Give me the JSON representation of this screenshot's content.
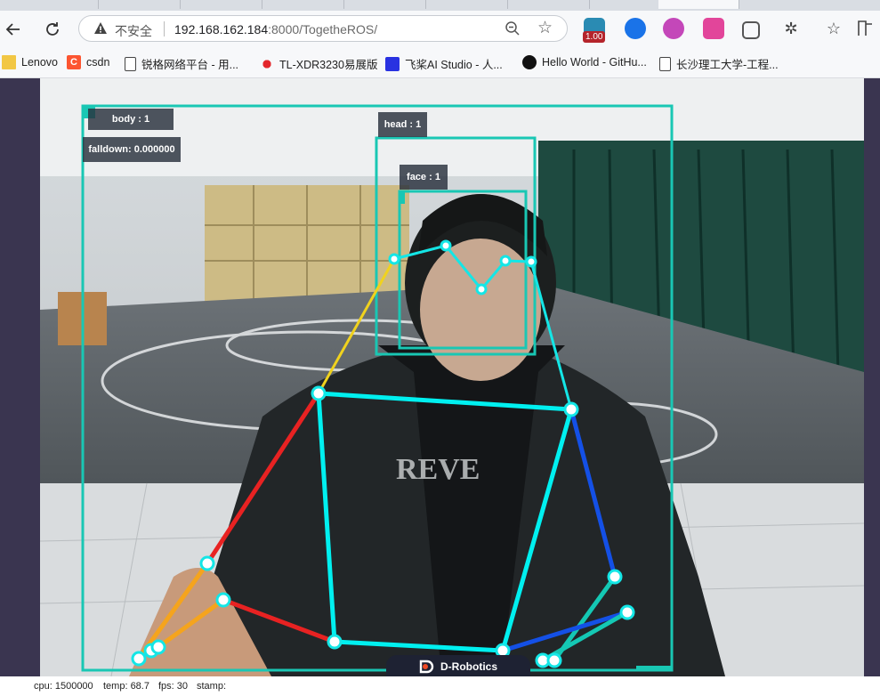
{
  "browser": {
    "security_label": "不安全",
    "url_host": "192.168.162.184",
    "url_rest": ":8000/TogetheROS/",
    "ext_badge": "1.00",
    "bookmarks": [
      {
        "label": "Lenovo",
        "icon": "folder-icon",
        "color": "#f2c744"
      },
      {
        "label": "csdn",
        "icon": "csdn-icon",
        "color": "#fc5531"
      },
      {
        "label": "锐格网络平台 - 用...",
        "icon": "page-icon",
        "color": "#ffffff"
      },
      {
        "label": "TL-XDR3230易展版",
        "icon": "huawei-icon",
        "color": "#e3262b"
      },
      {
        "label": "飞桨AI Studio - 人...",
        "icon": "paddle-icon",
        "color": "#2932e1"
      },
      {
        "label": "Hello World - GitHu...",
        "icon": "github-icon",
        "color": "#111111"
      },
      {
        "label": "长沙理工大学-工程...",
        "icon": "page-icon",
        "color": "#ffffff"
      }
    ]
  },
  "detections": {
    "body_label": "body : 1",
    "falldown_label": "falldown: 0.000000",
    "head_label": "head : 1",
    "face_label": "face : 1"
  },
  "branding": {
    "label": "D-Robotics"
  },
  "status": {
    "cpu": "cpu: 1500000",
    "temp": "temp: 68.7",
    "fps": "fps: 30",
    "stamp": "stamp:"
  },
  "colors": {
    "box": "#19c7b4",
    "face_mesh": "#14e6e6",
    "torso": "#00f0f0",
    "right_arm_upper": "#e82222",
    "right_forearm": "#f5a41d",
    "left_arm_upper": "#1450e6",
    "left_forearm": "#14c8b4",
    "neck_line": "#f0d21e"
  }
}
